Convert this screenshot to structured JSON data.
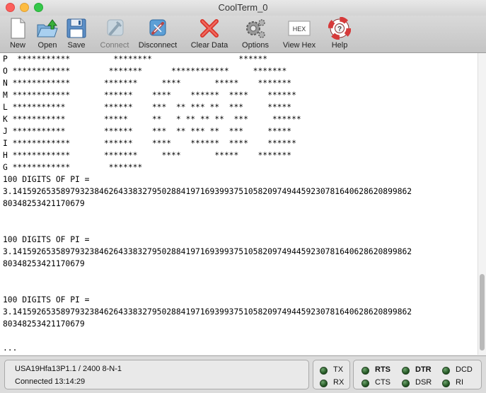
{
  "window": {
    "title": "CoolTerm_0"
  },
  "toolbar": {
    "new_label": "New",
    "open_label": "Open",
    "save_label": "Save",
    "connect_label": "Connect",
    "disconnect_label": "Disconnect",
    "clear_label": "Clear Data",
    "options_label": "Options",
    "viewhex_label": "View Hex",
    "viewhex_icon_text": "HEX",
    "help_label": "Help"
  },
  "terminal": {
    "lines": [
      "P  ***********         ********                  ******",
      "O ************        *******      ************     *******",
      "N ************       *******     ****       *****    *******",
      "M ************       ******    ****    ******  ****    ******",
      "L ***********        ******    ***  ** *** **  ***     *****",
      "K ***********        *****     **   * ** ** **  ***     ******",
      "J ***********        ******    ***  ** *** **  ***     *****",
      "I ************       ******    ****    ******  ****    ******",
      "H ************       *******     ****       *****    *******",
      "G ************        *******",
      "100 DIGITS OF PI =",
      "3.14159265358979323846264338327950288419716939937510582097494459230781640628620899862",
      "80348253421170679",
      "",
      "",
      "100 DIGITS OF PI =",
      "3.14159265358979323846264338327950288419716939937510582097494459230781640628620899862",
      "80348253421170679",
      "",
      "",
      "100 DIGITS OF PI =",
      "3.14159265358979323846264338327950288419716939937510582097494459230781640628620899862",
      "80348253421170679",
      "",
      "..."
    ]
  },
  "status": {
    "port_line": "USA19Hfa13P1.1 / 2400 8-N-1",
    "connection_line": "Connected 13:14:29",
    "tx": "TX",
    "rx": "RX",
    "rts": "RTS",
    "cts": "CTS",
    "dtr": "DTR",
    "dsr": "DSR",
    "dcd": "DCD",
    "ri": "RI"
  }
}
